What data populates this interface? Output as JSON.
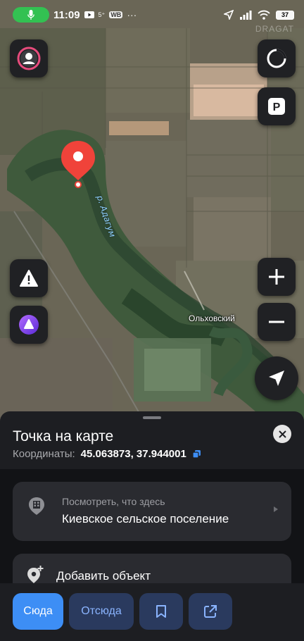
{
  "status_bar": {
    "time": "11:09",
    "network": "5⁺",
    "app_badge": "WB",
    "more": "···",
    "battery": "37"
  },
  "map": {
    "river_label": "р. Адагум",
    "town_label": "Ольховский",
    "watermark": "DRAGAT"
  },
  "sheet": {
    "title": "Точка на карте",
    "coords_label": "Координаты:",
    "coords_value": "45.063873, 37.944001",
    "whats_here_sub": "Посмотреть, что здесь",
    "whats_here_main": "Киевское сельское поселение",
    "add_object": "Добавить объект"
  },
  "actions": {
    "to_here": "Сюда",
    "from_here": "Отсюда"
  },
  "icons": {
    "profile": "profile-icon",
    "layers": "layers-icon",
    "parking": "parking-icon",
    "alert": "road-alert-icon",
    "alice": "alice-assistant-icon",
    "zoom_in": "plus-icon",
    "zoom_out": "minus-icon",
    "locate": "navigation-arrow-icon",
    "building": "building-icon",
    "add_place": "add-place-icon",
    "bookmark": "bookmark-icon",
    "share": "share-icon",
    "close": "close-icon",
    "copy": "copy-icon"
  },
  "colors": {
    "accent": "#3d8ef5",
    "pin": "#f0433a",
    "mic": "#33c152"
  }
}
